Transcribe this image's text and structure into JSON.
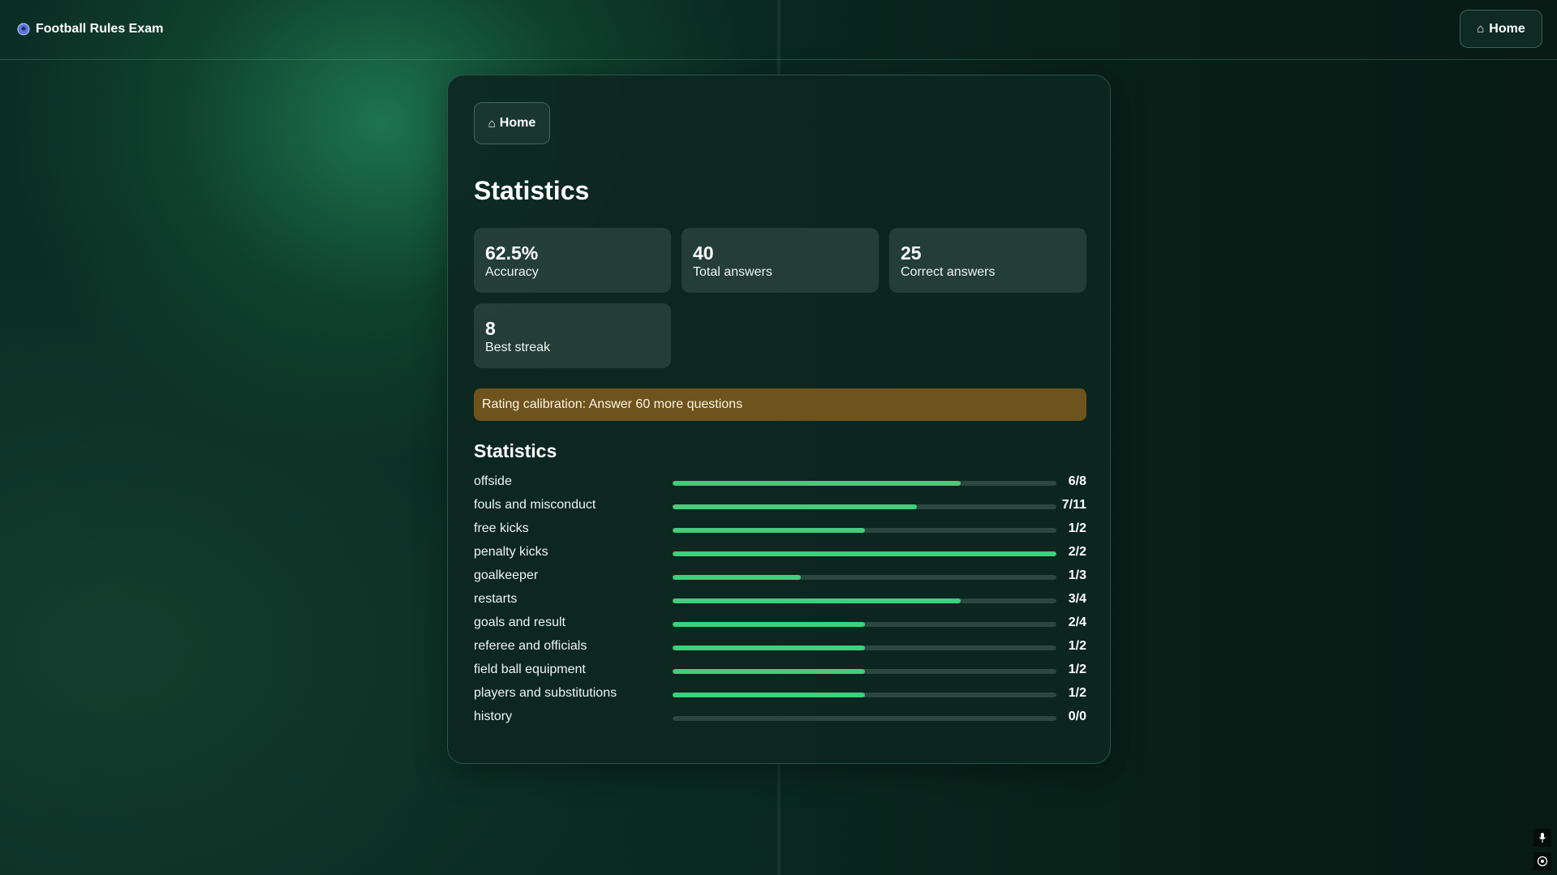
{
  "app": {
    "title": "Football Rules Exam",
    "icon": "soccer-ball-icon",
    "home_label": "Home",
    "home_icon": "home-icon"
  },
  "card": {
    "home_label": "Home",
    "title": "Statistics",
    "stats": [
      {
        "value": "62.5%",
        "label": "Accuracy"
      },
      {
        "value": "40",
        "label": "Total answers"
      },
      {
        "value": "25",
        "label": "Correct answers"
      },
      {
        "value": "8",
        "label": "Best streak"
      }
    ],
    "banner": "Rating calibration: Answer 60 more questions",
    "banner_color": "#6e531d",
    "section_title": "Statistics",
    "accent_color": "#3fcf7d",
    "categories": [
      {
        "name": "offside",
        "correct": 6,
        "total": 8,
        "count": "6/8"
      },
      {
        "name": "fouls and misconduct",
        "correct": 7,
        "total": 11,
        "count": "7/11"
      },
      {
        "name": "free kicks",
        "correct": 1,
        "total": 2,
        "count": "1/2"
      },
      {
        "name": "penalty kicks",
        "correct": 2,
        "total": 2,
        "count": "2/2"
      },
      {
        "name": "goalkeeper",
        "correct": 1,
        "total": 3,
        "count": "1/3"
      },
      {
        "name": "restarts",
        "correct": 3,
        "total": 4,
        "count": "3/4"
      },
      {
        "name": "goals and result",
        "correct": 2,
        "total": 4,
        "count": "2/4"
      },
      {
        "name": "referee and officials",
        "correct": 1,
        "total": 2,
        "count": "1/2"
      },
      {
        "name": "field ball equipment",
        "correct": 1,
        "total": 2,
        "count": "1/2"
      },
      {
        "name": "players and substitutions",
        "correct": 1,
        "total": 2,
        "count": "1/2"
      },
      {
        "name": "history",
        "correct": 0,
        "total": 0,
        "count": "0/0"
      }
    ]
  },
  "corner_controls": [
    "microphone-icon",
    "settings-icon"
  ]
}
